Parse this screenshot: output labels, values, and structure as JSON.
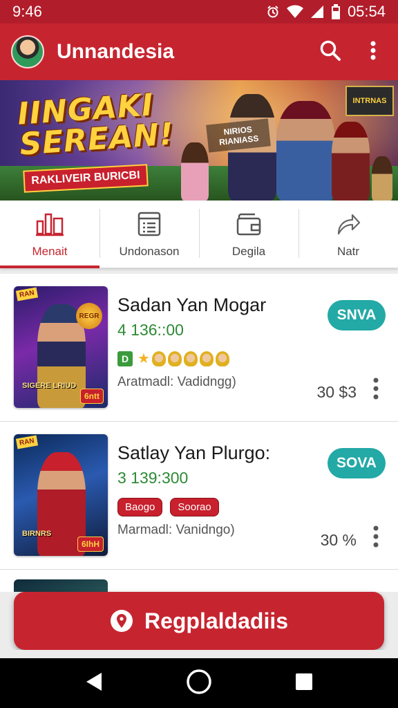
{
  "status_bar": {
    "time": "9:46",
    "clock": "05:54"
  },
  "app_bar": {
    "title": "Unnandesia"
  },
  "banner": {
    "headline_line1": "IINGAKI",
    "headline_line2": "SEREAN!",
    "ribbon": "RAKLIVEIR BURICBI",
    "sign": "INTRNAS",
    "sub": "NIRIOS RIANIASS"
  },
  "tabs": [
    {
      "label": "Menait",
      "icon": "chart-icon",
      "active": true
    },
    {
      "label": "Undonason",
      "icon": "list-icon",
      "active": false
    },
    {
      "label": "Degila",
      "icon": "wallet-icon",
      "active": false
    },
    {
      "label": "Natr",
      "icon": "share-icon",
      "active": false
    }
  ],
  "items": [
    {
      "title": "Sadan Yan Mogar",
      "meta": "4 136::00",
      "badge_letter": "D",
      "desc": "Aratmadl: Vadidngg)",
      "action": "SNVA",
      "price": "30 $3",
      "thumb_corner": "RAN",
      "thumb_tag": "6ntt",
      "thumb_coin": "REGR",
      "thumb_word": "SIGERE LRIUD"
    },
    {
      "title": "Satlay Yan Plurgo:",
      "meta": "3 139:300",
      "pills": [
        "Baogo",
        "Soorao"
      ],
      "desc": "Marmadl: Vanidngo)",
      "action": "SOVA",
      "price": "30 %",
      "thumb_corner": "RAN",
      "thumb_tag": "6IhH",
      "thumb_word": "BIRNRS"
    }
  ],
  "cta": {
    "label": "Regplaldadiis"
  },
  "colors": {
    "primary": "#c62530",
    "status": "#b21d2b",
    "teal": "#23a9a6",
    "green": "#2d8a34"
  }
}
